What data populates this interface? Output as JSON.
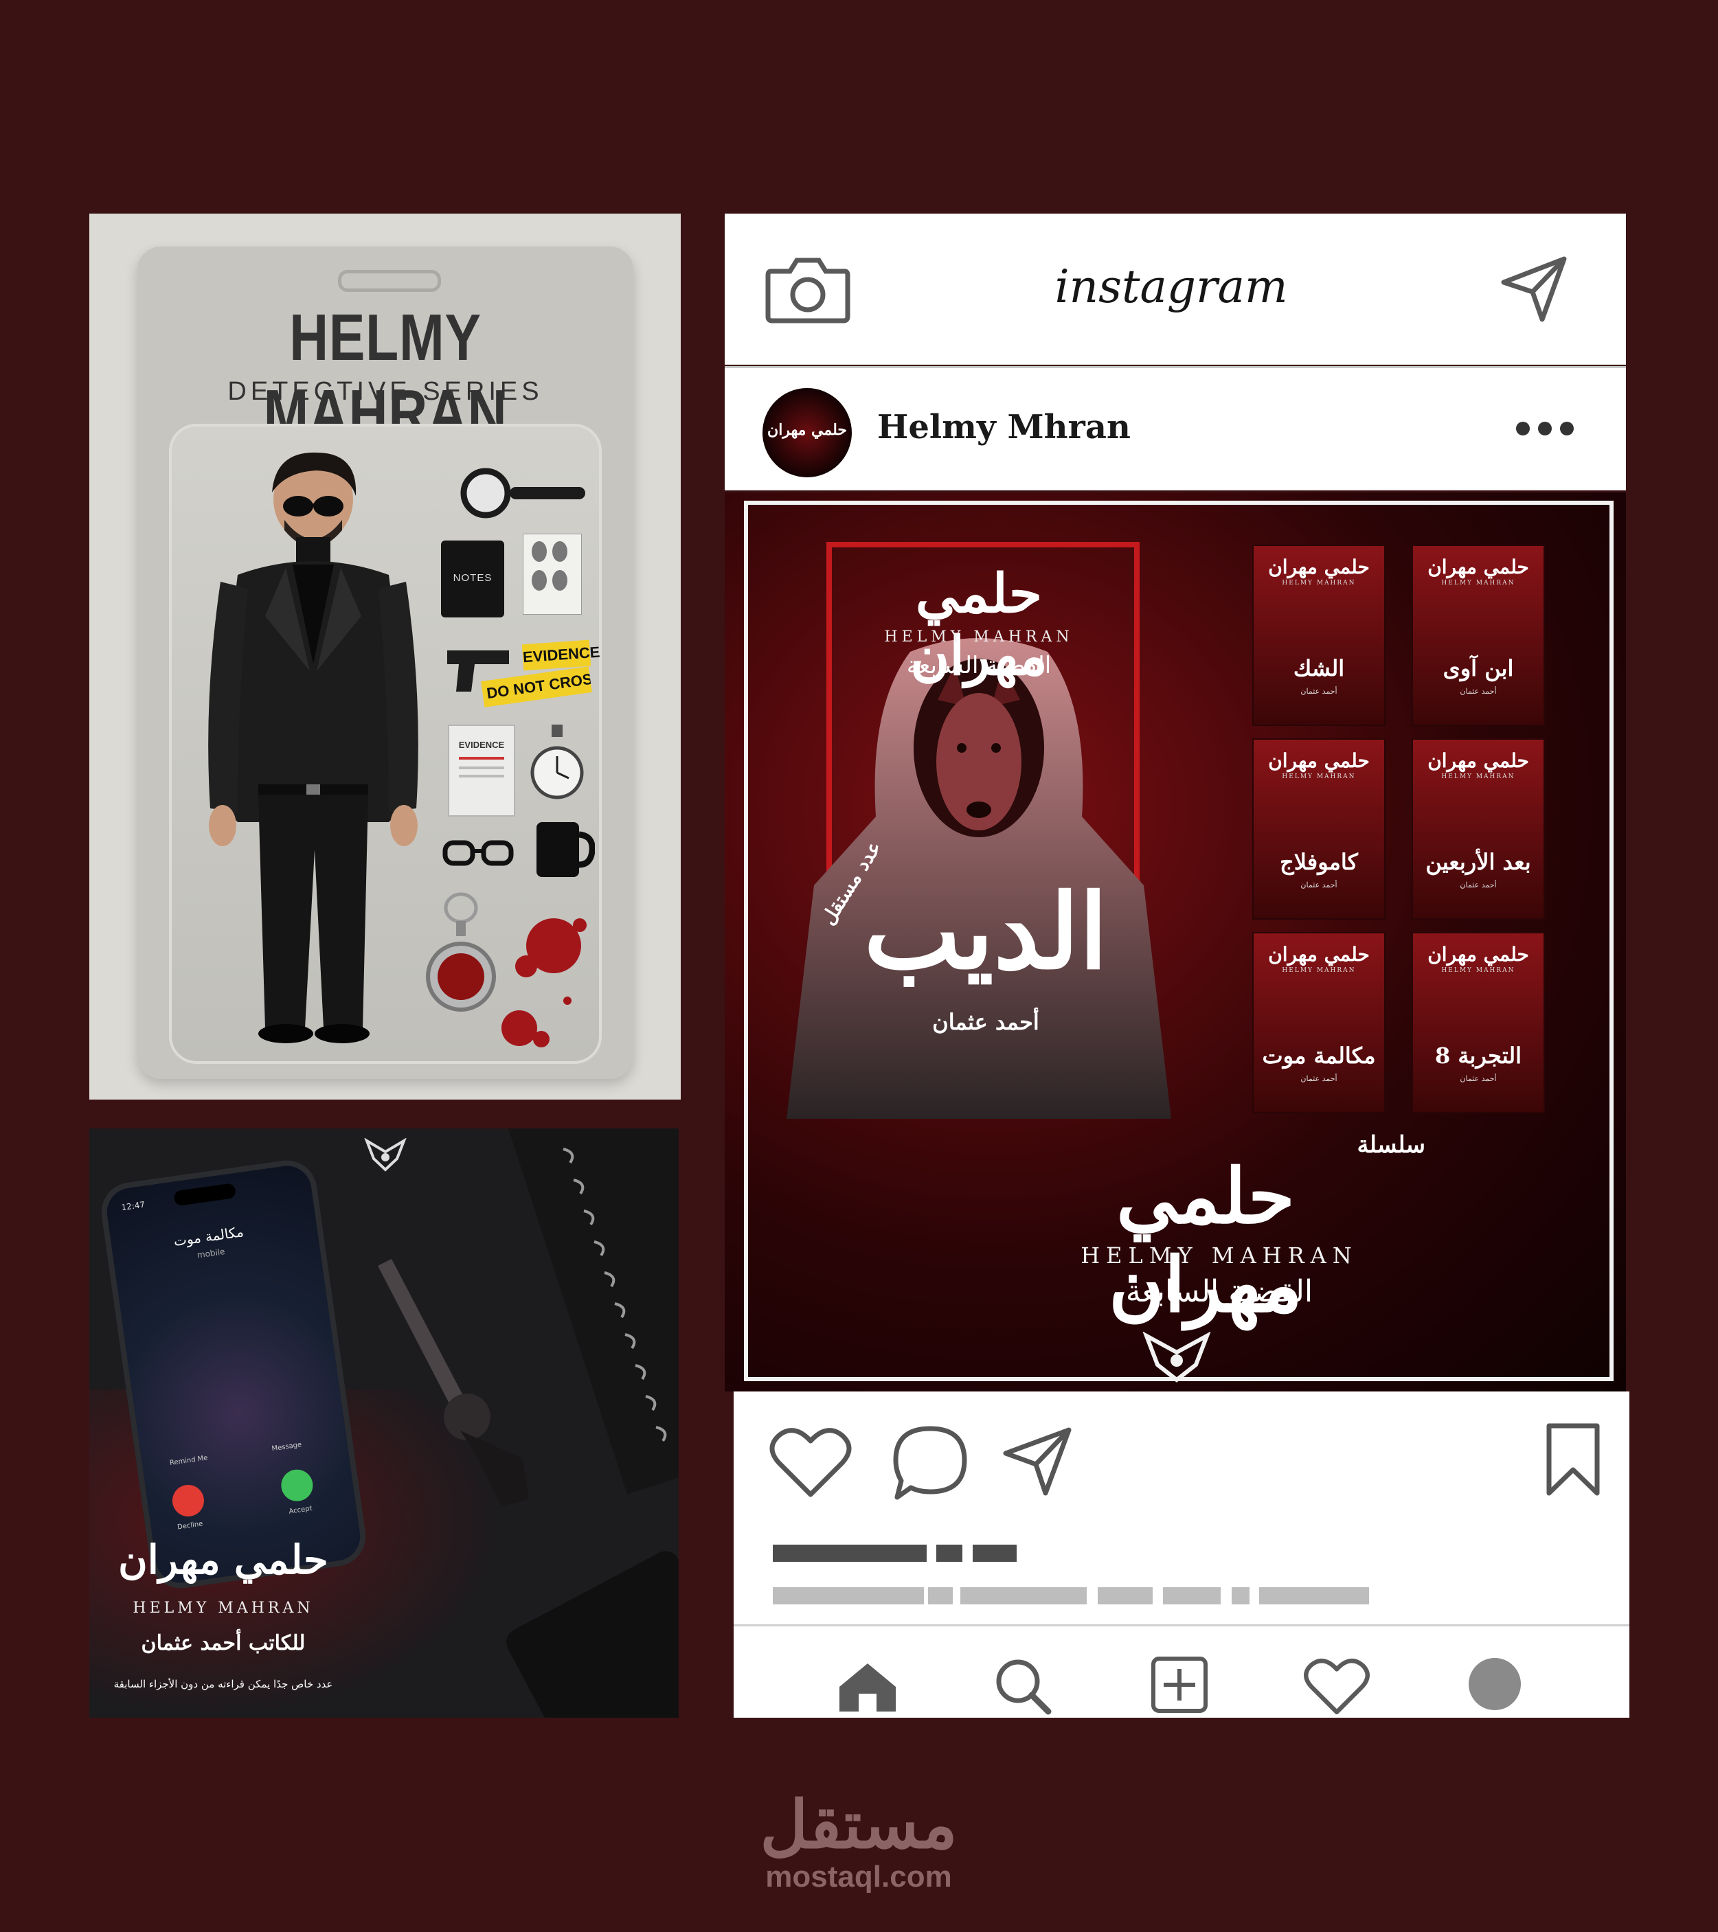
{
  "figure_card": {
    "title": "HELMY MAHRAN",
    "subtitle": "DETECTIVE SERIES",
    "notebook_label": "NOTES",
    "tape_1": "EVIDENCE",
    "tape_2": "DO NOT CROSS",
    "evidence_bag_label": "EVIDENCE"
  },
  "promo": {
    "phone_time": "12:47",
    "caller_name": "مكالمة موت",
    "caller_sub": "mobile",
    "remind_label": "Remind Me",
    "message_label": "Message",
    "decline_label": "Decline",
    "accept_label": "Accept",
    "series_title_ar": "حلمي مهران",
    "series_title_en": "HELMY MAHRAN",
    "author_line": "للكاتب أحمد عثمان",
    "tagline": "عدد خاص جدًا يمكن قراءته من دون الأجزاء السابقة"
  },
  "instagram": {
    "logo": "instagram",
    "username": "Helmy Mhran",
    "icons": {
      "camera": "camera-icon",
      "send": "send-icon",
      "more": "more-options-icon",
      "like": "heart-icon",
      "comment": "comment-icon",
      "share": "share-icon",
      "save": "bookmark-icon",
      "home": "home-icon",
      "search": "search-icon",
      "add": "add-post-icon",
      "activity": "activity-heart-icon",
      "profile": "profile-icon"
    },
    "post": {
      "cover": {
        "series_ar": "حلمي مهران",
        "series_en": "HELMY MAHRAN",
        "case_ar": "القضية السابعة",
        "badge_ar": "عدد مستقل",
        "book_title_ar": "الديب",
        "author_ar": "أحمد عثمان"
      },
      "series_label_ar": "سلسلة",
      "series_ar": "حلمي مهران",
      "series_en": "HELMY MAHRAN",
      "case_ar": "القضية السابعة",
      "thumbnails": [
        {
          "title": "الشك",
          "brand": "حلمي مهران",
          "brand_en": "HELMY MAHRAN",
          "author": "أحمد عثمان"
        },
        {
          "title": "ابن آوى",
          "brand": "حلمي مهران",
          "brand_en": "HELMY MAHRAN",
          "author": "أحمد عثمان"
        },
        {
          "title": "كاموفلاج",
          "brand": "حلمي مهران",
          "brand_en": "HELMY MAHRAN",
          "author": "أحمد عثمان"
        },
        {
          "title": "بعد الأربعين",
          "brand": "حلمي مهران",
          "brand_en": "HELMY MAHRAN",
          "author": "أحمد عثمان"
        },
        {
          "title": "مكالمة موت",
          "brand": "حلمي مهران",
          "brand_en": "HELMY MAHRAN",
          "author": "أحمد عثمان"
        },
        {
          "title": "التجربة 8",
          "brand": "حلمي مهران",
          "brand_en": "HELMY MAHRAN",
          "author": "أحمد عثمان"
        }
      ]
    }
  },
  "watermark": {
    "ar": "مستقل",
    "url": "mostaql.com"
  },
  "colors": {
    "background": "#3b1214",
    "accent_red": "#c41a1d",
    "skeleton_dark": "#4c4c4c",
    "skeleton_light": "#bdbdbd"
  }
}
